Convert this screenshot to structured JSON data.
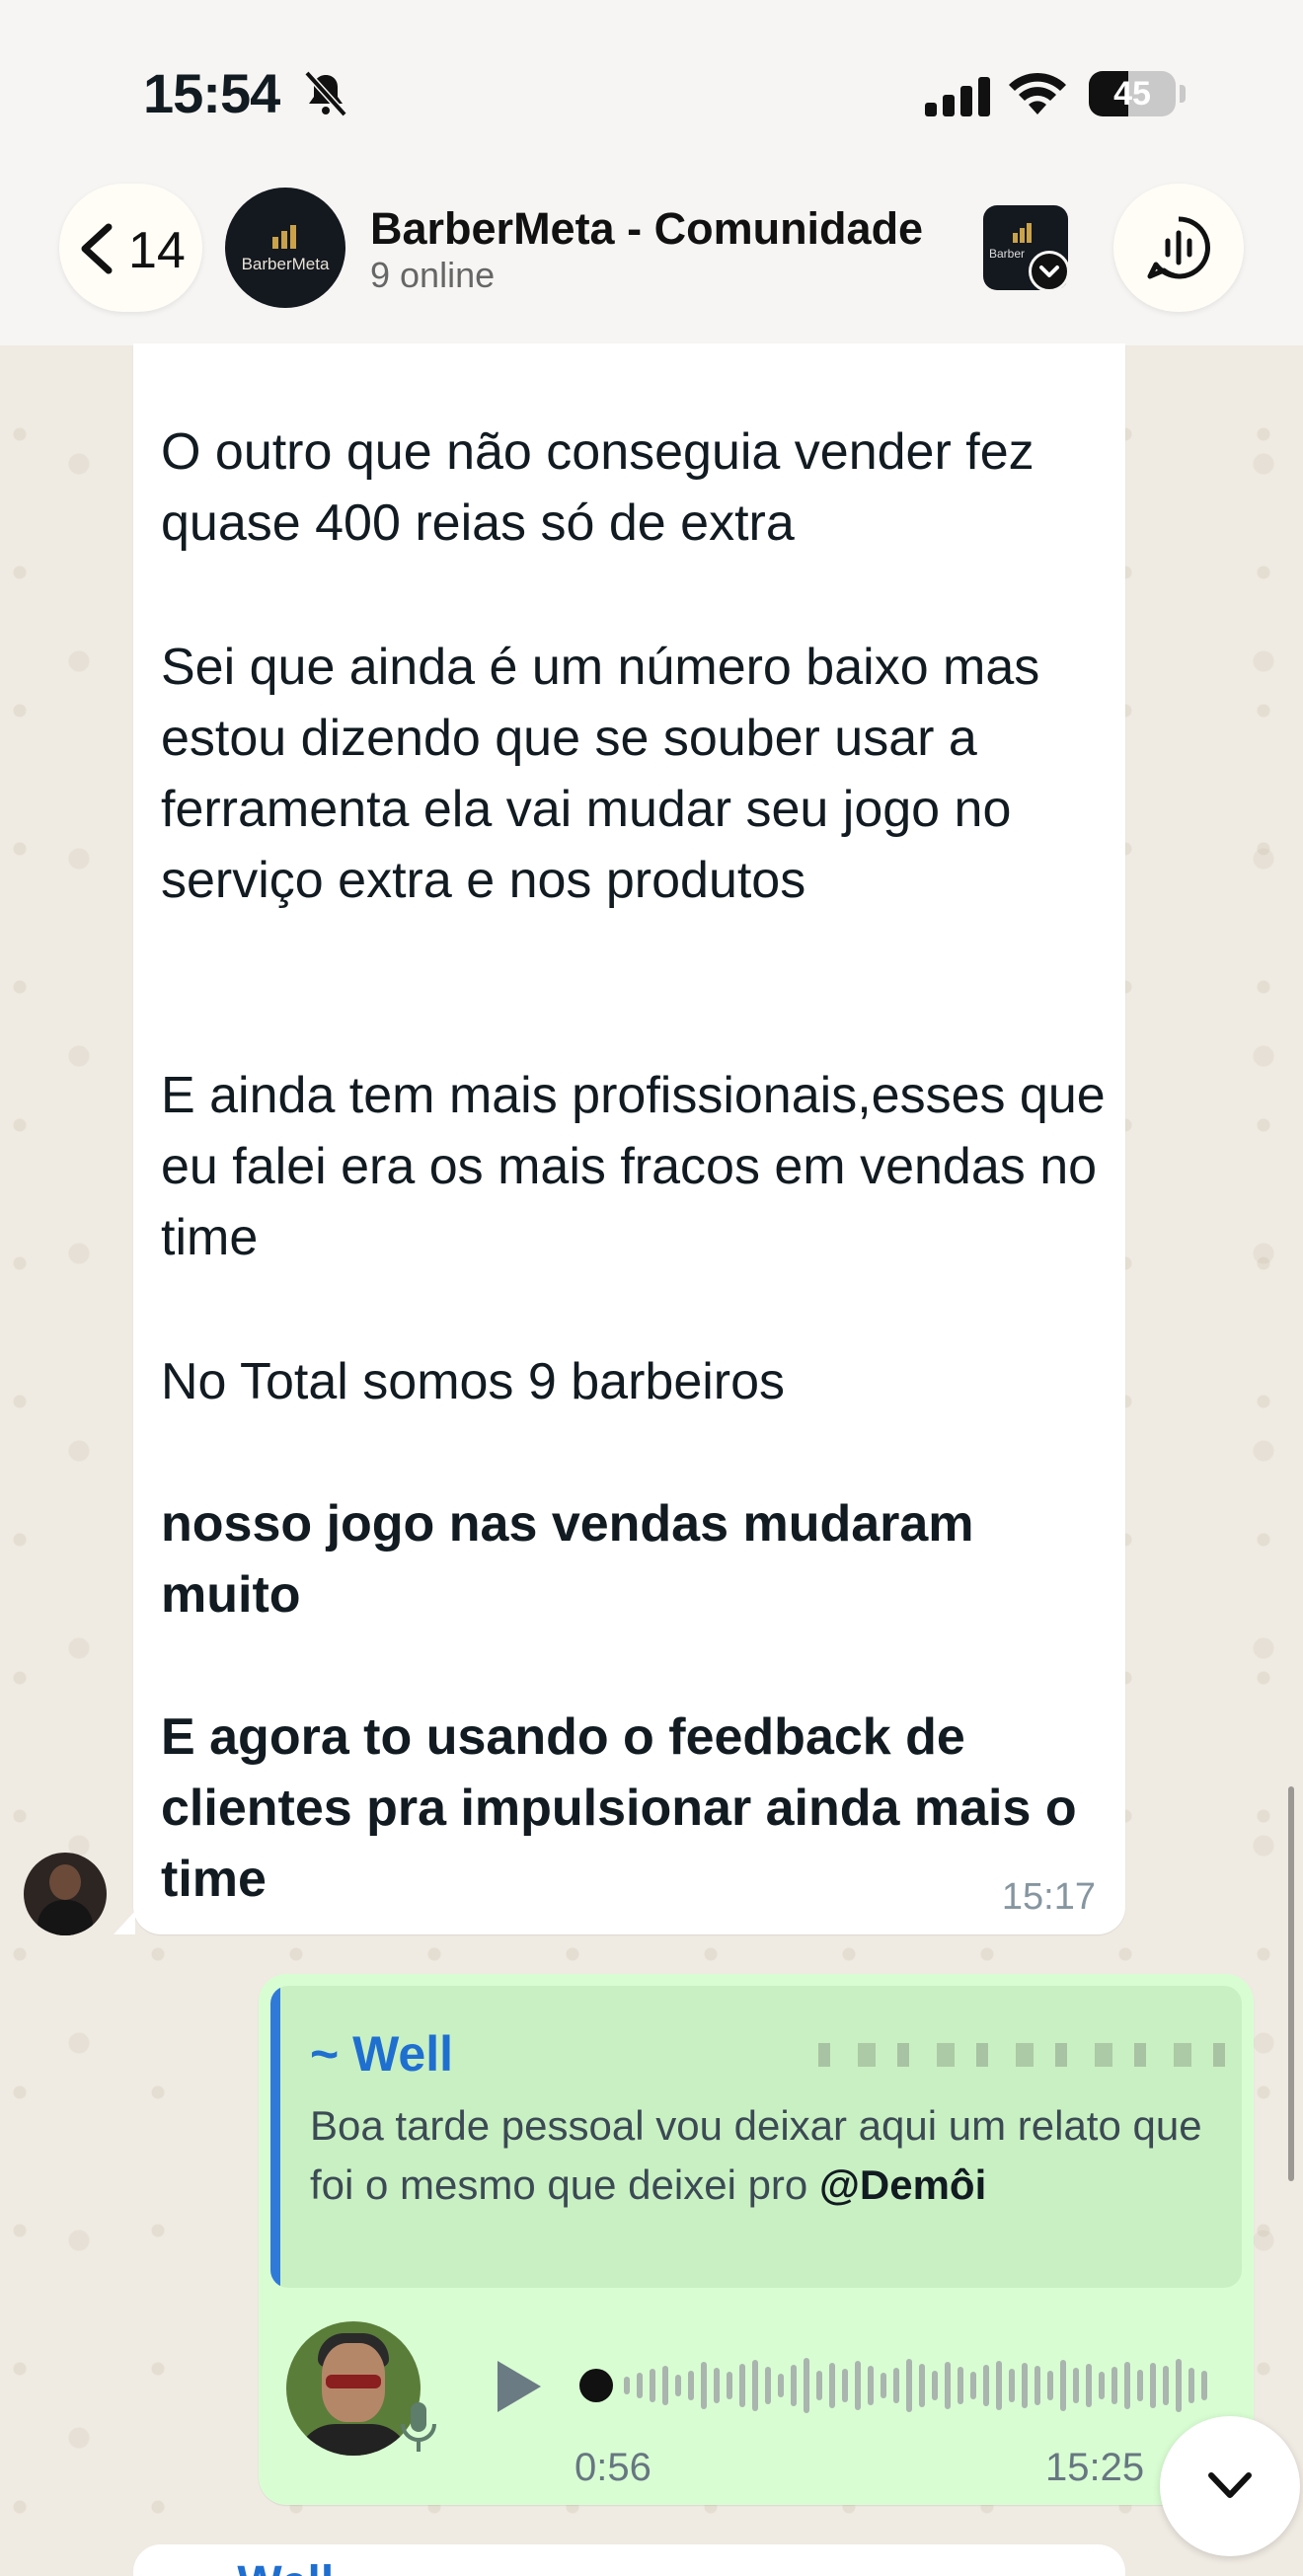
{
  "status_bar": {
    "time": "15:54",
    "battery": "45"
  },
  "header": {
    "back_count": "14",
    "avatar_text": "BarberMeta",
    "title": "BarberMeta - Comunidade",
    "subtitle": "9 online",
    "community_text": "Barber"
  },
  "received_message": {
    "paragraphs": [
      "O outro que não conseguia vender fez quase 400 reias só de extra",
      "Sei que ainda é um número baixo mas estou dizendo que se souber usar a ferramenta ela vai mudar seu jogo no serviço extra e nos produtos",
      "E ainda tem mais profissionais,esses  que eu falei era os mais fracos em vendas no time",
      "No Total somos 9 barbeiros",
      "nosso jogo nas vendas mudaram muito",
      "E agora to usando o feedback de clientes pra impulsionar ainda mais o time"
    ],
    "time": "15:17"
  },
  "sent_message": {
    "quote": {
      "author": "~ Well",
      "text": "Boa tarde pessoal vou deixar aqui um relato que foi o mesmo que deixei pro ",
      "mention": "@Demôi"
    },
    "voice": {
      "duration": "0:56"
    },
    "time": "15:25"
  },
  "next_message": {
    "author": "~ Well"
  },
  "colors": {
    "chat_bg": "#efeae2",
    "sent_bubble": "#d9fdd3",
    "quote_accent": "#2f7ad8",
    "author_blue": "#1f6fd1"
  }
}
